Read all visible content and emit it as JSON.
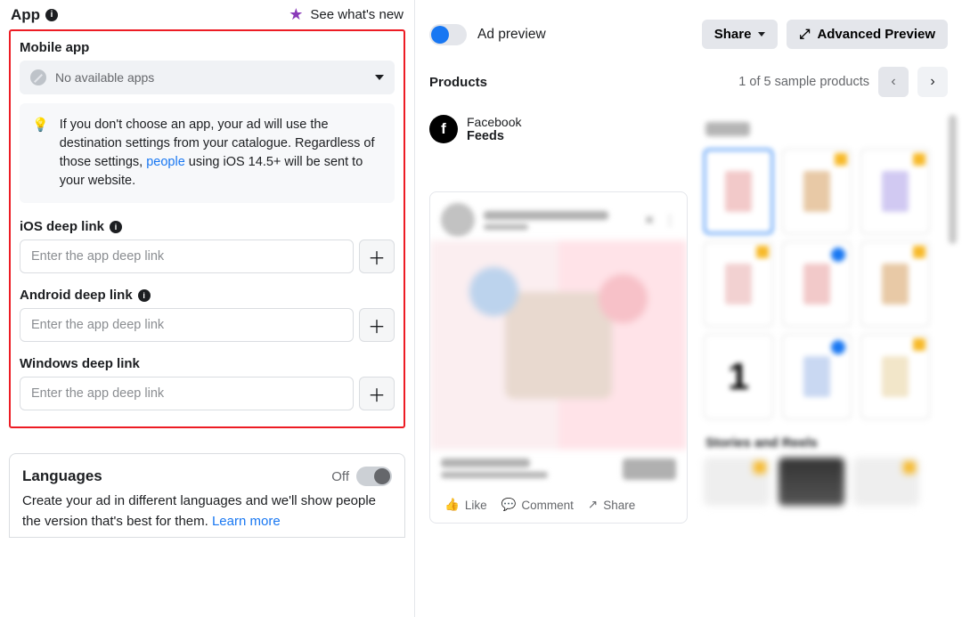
{
  "header": {
    "title": "App",
    "whatsnew": "See what's new"
  },
  "app_section": {
    "mobile_label": "Mobile app",
    "select_placeholder": "No available apps",
    "tip_prefix": "If you don't choose an app, your ad will use the destination settings from your catalogue. Regardless of those settings, ",
    "tip_link": "people",
    "tip_suffix": " using iOS 14.5+ will be sent to your website.",
    "ios_label": "iOS deep link",
    "android_label": "Android deep link",
    "windows_label": "Windows deep link",
    "input_placeholder": "Enter the app deep link"
  },
  "languages": {
    "title": "Languages",
    "state": "Off",
    "desc": "Create your ad in different languages and we'll show people the version that's best for them. ",
    "learn": "Learn more"
  },
  "preview": {
    "title": "Ad preview",
    "share": "Share",
    "advanced": "Advanced Preview"
  },
  "products": {
    "title": "Products",
    "counter": "1 of 5 sample products"
  },
  "feed": {
    "platform": "Facebook",
    "placement": "Feeds",
    "like": "Like",
    "comment": "Comment",
    "share": "Share"
  },
  "side": {
    "stories": "Stories and Reels"
  }
}
